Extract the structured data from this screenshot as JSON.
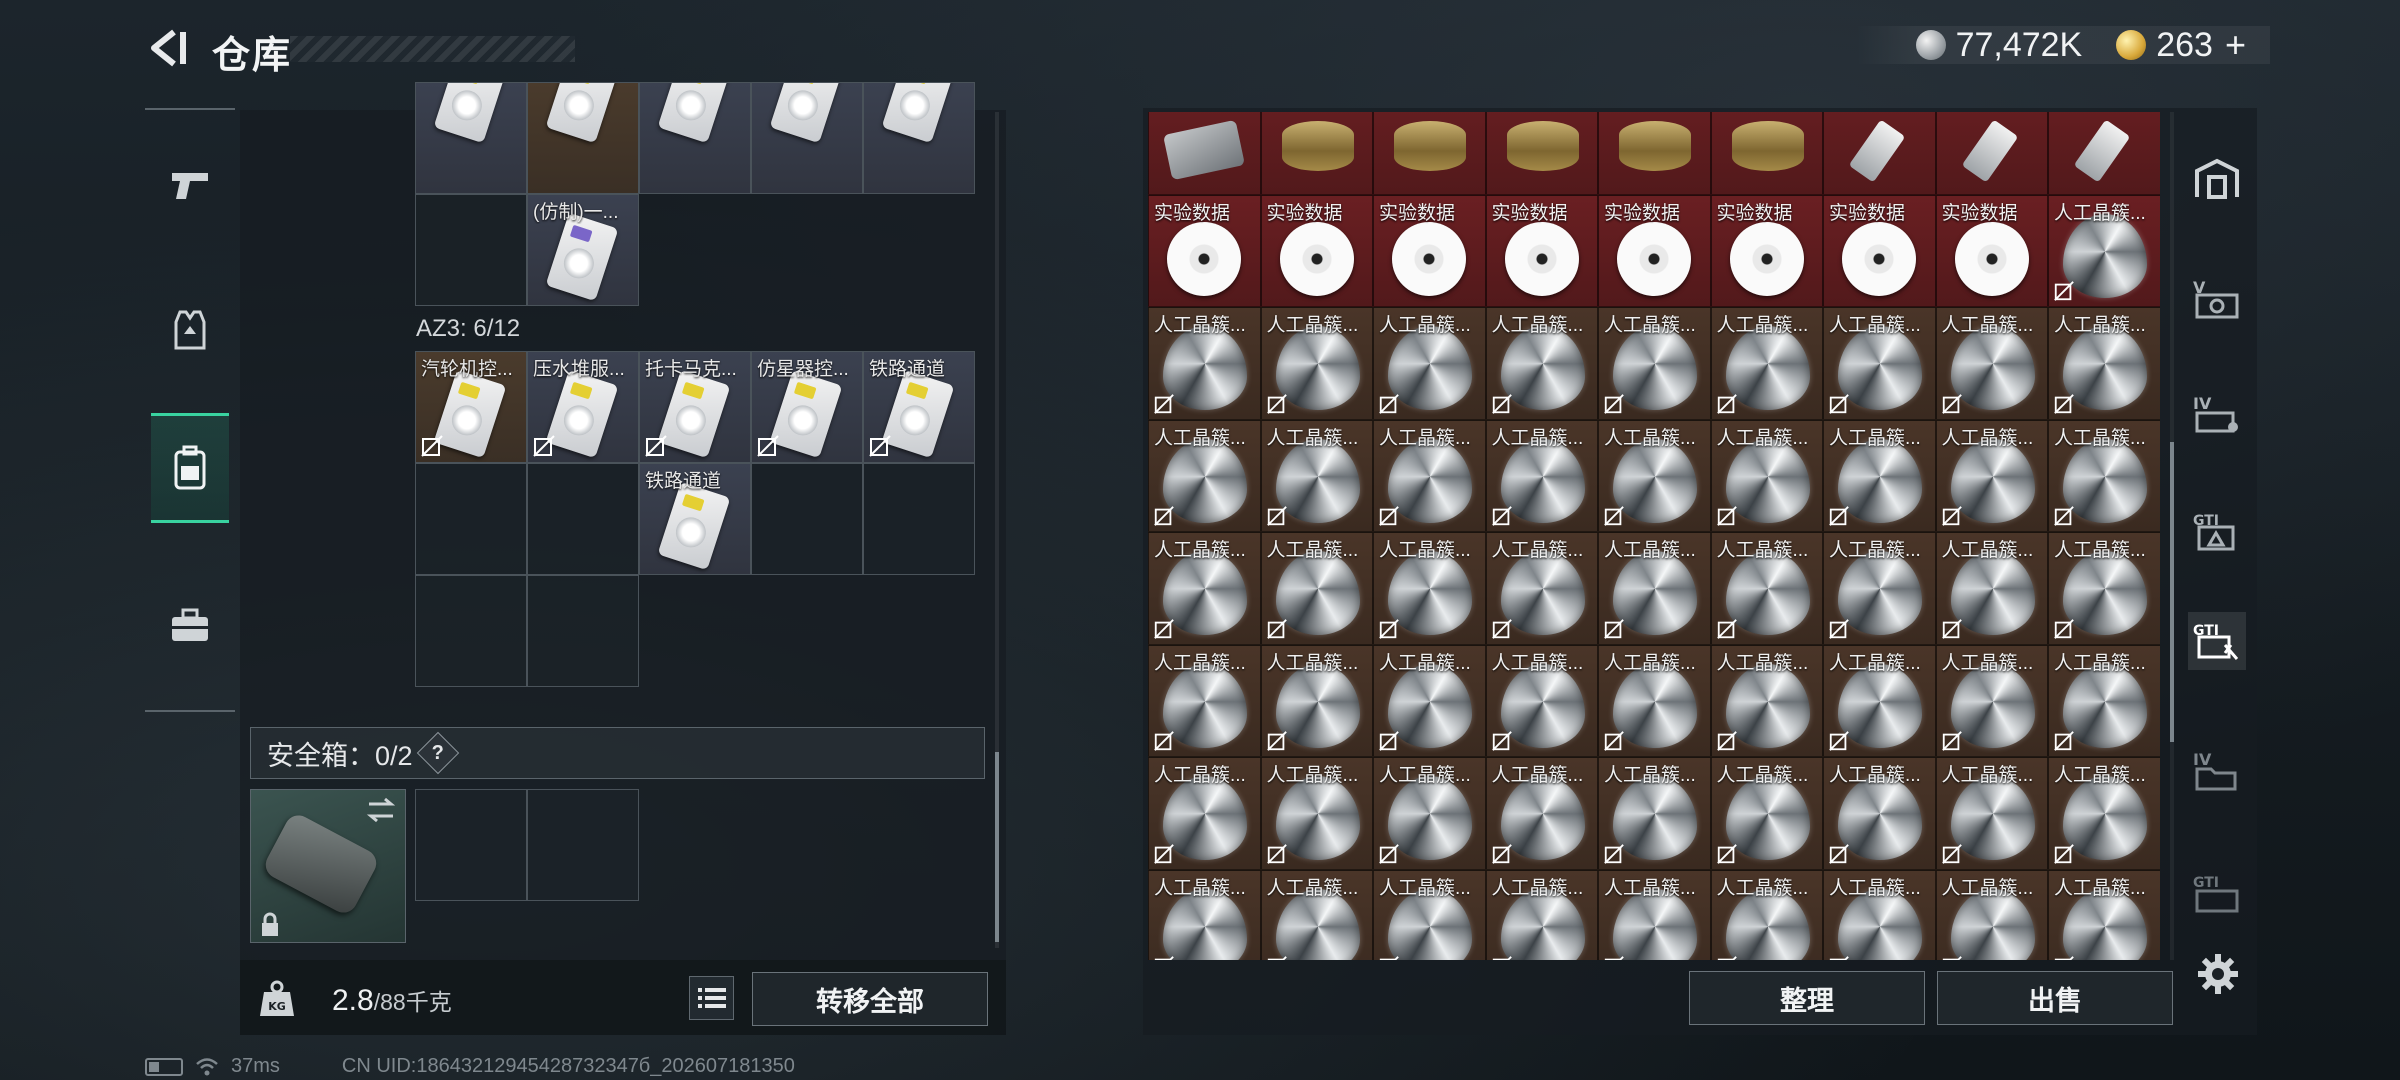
{
  "header": {
    "title": "仓库",
    "currencies": [
      {
        "icon": "silver-coin-icon",
        "value": "77,472K"
      },
      {
        "icon": "gold-coin-icon",
        "value": "263",
        "suffix": "+"
      }
    ]
  },
  "left_nav": {
    "items": [
      {
        "icon": "pistol-icon",
        "active": false
      },
      {
        "icon": "vest-icon",
        "active": false
      },
      {
        "icon": "backpack-icon",
        "active": true
      },
      {
        "icon": "briefcase-icon",
        "active": false
      }
    ]
  },
  "backpack": {
    "top_rows": [
      [
        {
          "label": "",
          "tint": "blue"
        },
        {
          "label": "",
          "tint": "brown"
        },
        {
          "label": "",
          "tint": "blue"
        },
        {
          "label": "",
          "tint": "blue"
        },
        {
          "label": "",
          "tint": "blue"
        }
      ],
      [
        {
          "label": "",
          "tint": "empty"
        },
        {
          "label": "(仿制)一...",
          "tint": "blue"
        }
      ]
    ],
    "section": {
      "label": "AZ3: 6/12",
      "items": [
        {
          "label": "汽轮机控...",
          "tint": "brown"
        },
        {
          "label": "压水堆服...",
          "tint": "blue"
        },
        {
          "label": "托卡马克...",
          "tint": "blue"
        },
        {
          "label": "仿星器控...",
          "tint": "blue"
        },
        {
          "label": "铁路通道",
          "tint": "blue"
        },
        {
          "label": "铁路通道",
          "tint": "blue"
        }
      ]
    },
    "safe_box": {
      "label": "安全箱：0/2",
      "help": "?"
    },
    "weight": {
      "current": "2.8",
      "max": "/88千克"
    },
    "transfer_all": "转移全部"
  },
  "storage": {
    "rows": [
      [
        {
          "label": "",
          "item": "device",
          "tint": "red"
        },
        {
          "label": "",
          "item": "tin",
          "tint": "red"
        },
        {
          "label": "",
          "item": "tin",
          "tint": "red"
        },
        {
          "label": "",
          "item": "tin",
          "tint": "red"
        },
        {
          "label": "",
          "item": "tin",
          "tint": "red"
        },
        {
          "label": "",
          "item": "tin",
          "tint": "red"
        },
        {
          "label": "",
          "item": "usb",
          "tint": "red"
        },
        {
          "label": "",
          "item": "usb",
          "tint": "red"
        },
        {
          "label": "",
          "item": "usb",
          "tint": "red"
        }
      ],
      [
        {
          "label": "实验数据",
          "item": "disc",
          "tint": "red"
        },
        {
          "label": "实验数据",
          "item": "disc",
          "tint": "red"
        },
        {
          "label": "实验数据",
          "item": "disc",
          "tint": "red"
        },
        {
          "label": "实验数据",
          "item": "disc",
          "tint": "red"
        },
        {
          "label": "实验数据",
          "item": "disc",
          "tint": "red"
        },
        {
          "label": "实验数据",
          "item": "disc",
          "tint": "red"
        },
        {
          "label": "实验数据",
          "item": "disc",
          "tint": "red"
        },
        {
          "label": "实验数据",
          "item": "disc",
          "tint": "red"
        },
        {
          "label": "人工晶簇...",
          "item": "diamond",
          "tint": "red"
        }
      ]
    ],
    "crystal_label": "人工晶簇...",
    "crystal_rows": 6,
    "columns": 9,
    "sort_button": "整理",
    "sell_button": "出售"
  },
  "right_nav": {
    "items": [
      {
        "icon": "safe-house-icon",
        "active": false
      },
      {
        "icon": "storage-v-icon",
        "active": false
      },
      {
        "icon": "storage-iv-icon",
        "active": false
      },
      {
        "icon": "storage-gti-a-icon",
        "active": false
      },
      {
        "icon": "storage-gti-b-icon",
        "active": true
      },
      {
        "icon": "storage-iv-folder-icon",
        "active": false
      },
      {
        "icon": "storage-gti-c-icon",
        "active": false
      }
    ]
  },
  "status_bar": {
    "ping": "37ms",
    "uid": "CN UID:18643212945428732347б_202607181350"
  }
}
